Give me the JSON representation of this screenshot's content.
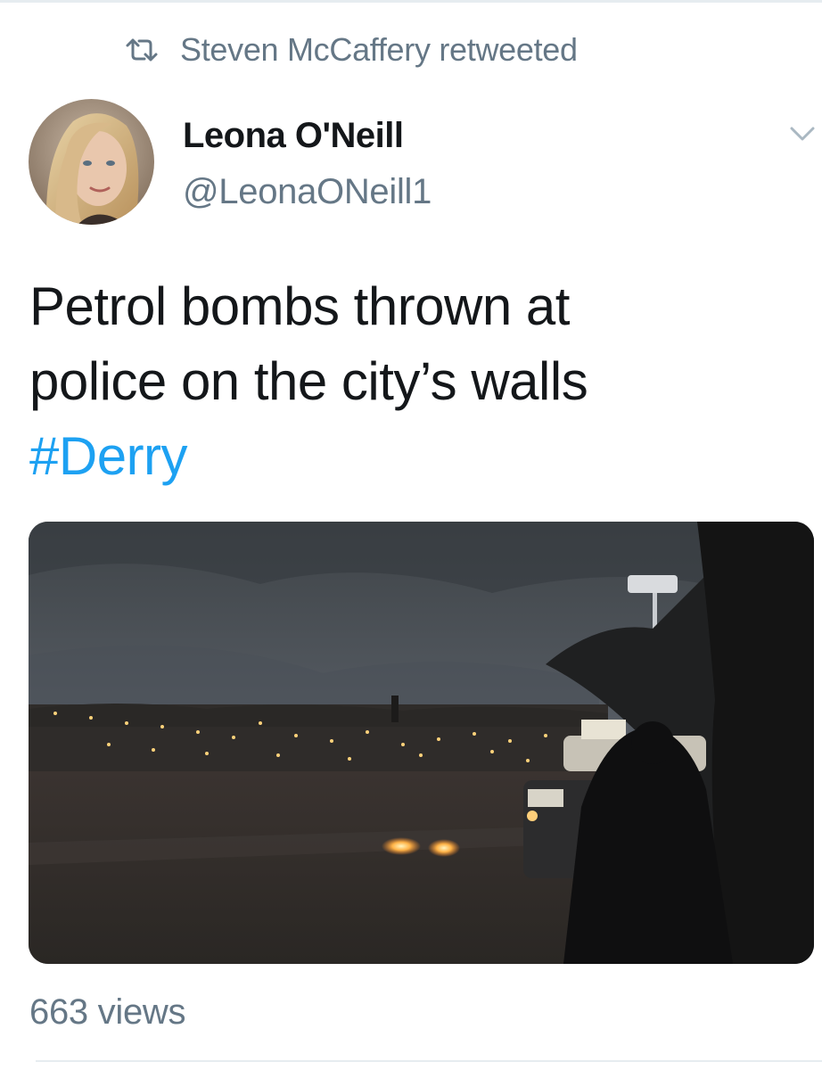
{
  "retweet": {
    "icon": "retweet-icon",
    "text": "Steven McCaffery retweeted"
  },
  "author": {
    "name": "Leona O'Neill",
    "handle": "@LeonaONeill1",
    "avatar_icon": "avatar"
  },
  "menu": {
    "icon": "chevron-down-icon"
  },
  "tweet": {
    "line1": "Petrol bombs thrown at",
    "line2": "police on the city’s walls",
    "hashtag": "#Derry"
  },
  "media": {
    "type": "video-thumbnail"
  },
  "stats": {
    "views": "663 views"
  },
  "colors": {
    "text": "#14171a",
    "muted": "#657786",
    "link": "#1da1f2",
    "divider": "#e6ecf0"
  }
}
